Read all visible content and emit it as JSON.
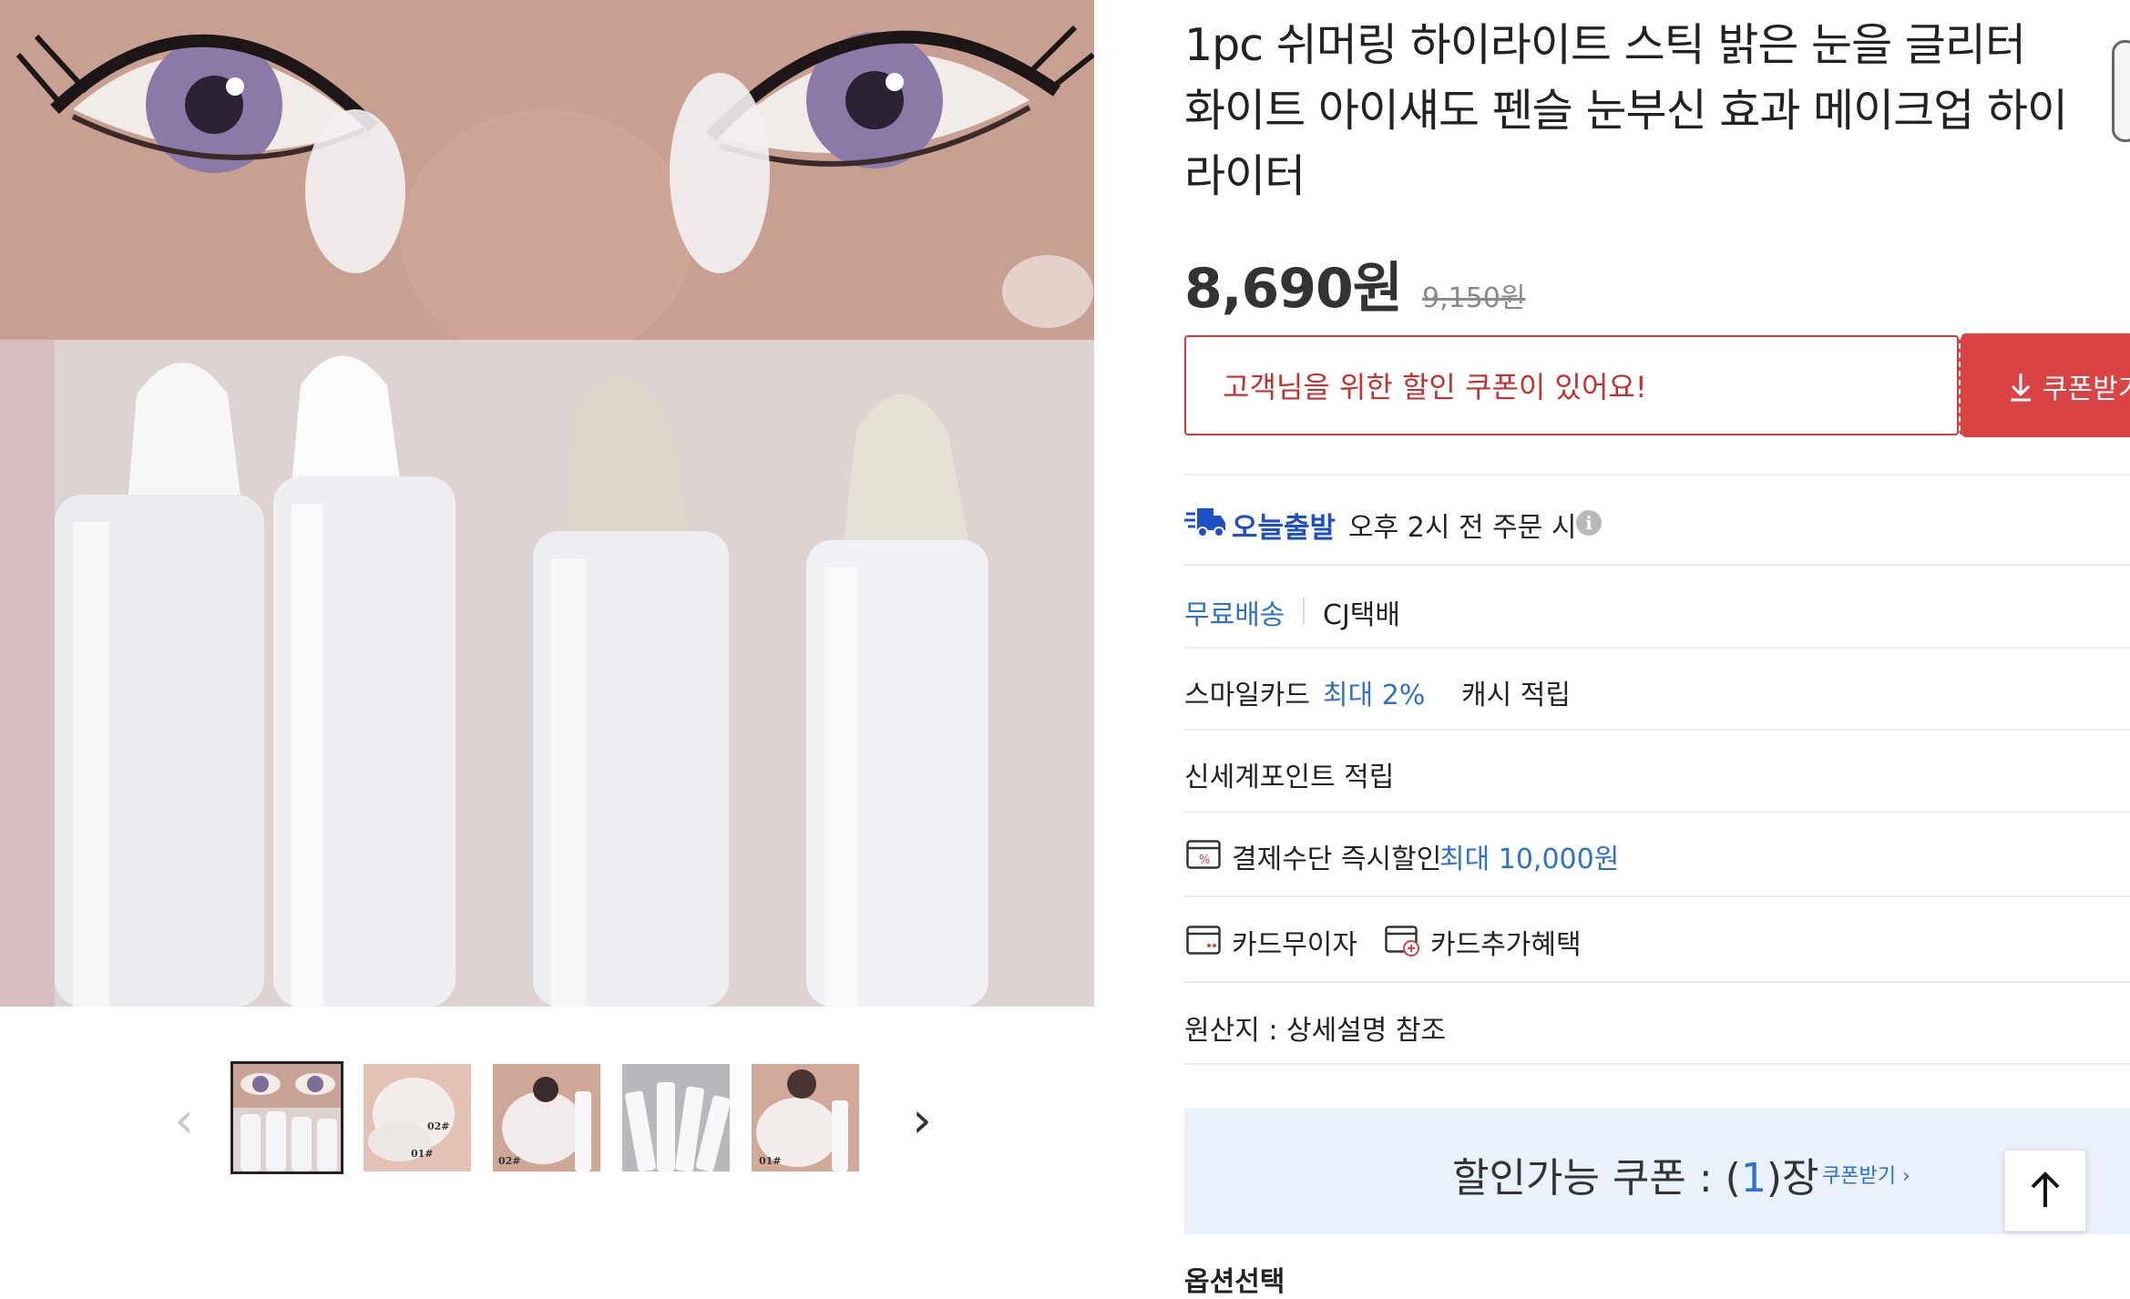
{
  "product": {
    "title": "1pc 쉬머링 하이라이트 스틱 밝은 눈을 글리터 화이트 아이섀도 펜슬 눈부신 효과 메이크업 하이라이터",
    "price": "8,690원",
    "original_price": "9,150원"
  },
  "coupon": {
    "message": "고객님을 위한 할인 쿠폰이 있어요!",
    "button_label": "쿠폰받기"
  },
  "shipping": {
    "today_badge": "오늘출발",
    "today_condition": "오후 2시 전 주문 시",
    "info_icon": "i",
    "free_label": "무료배송",
    "courier": "CJ택배"
  },
  "benefits": {
    "smile_card_prefix": "스마일카드",
    "smile_card_highlight": "최대 2%",
    "smile_card_suffix": "캐시 적립",
    "shinsegae_point": "신세계포인트 적립",
    "payment_discount_label": "결제수단 즉시할인",
    "payment_discount_highlight": "최대 10,000원",
    "card_no_interest": "카드무이자",
    "card_extra": "카드추가혜택"
  },
  "origin": "원산지 : 상세설명 참조",
  "coupon_banner": {
    "prefix": "할인가능 쿠폰 : (",
    "count": "1",
    "suffix": ")장",
    "link": "쿠폰받기 ›"
  },
  "options": {
    "title": "옵션선택"
  },
  "gallery": {
    "prev_arrow": "‹",
    "next_arrow": "›",
    "thumb_labels": [
      "02#",
      "01#",
      "02#",
      "01#"
    ],
    "active_index": 0,
    "count": 5
  },
  "colors": {
    "accent_red": "#d94343",
    "accent_blue": "#2d72c8",
    "banner_bg": "#eaf1fb"
  },
  "icons": [
    "truck-icon",
    "info-icon",
    "percent-card-icon",
    "card-icon",
    "card-plus-icon",
    "download-icon",
    "arrow-up-icon",
    "chevron-left-icon",
    "chevron-right-icon"
  ]
}
